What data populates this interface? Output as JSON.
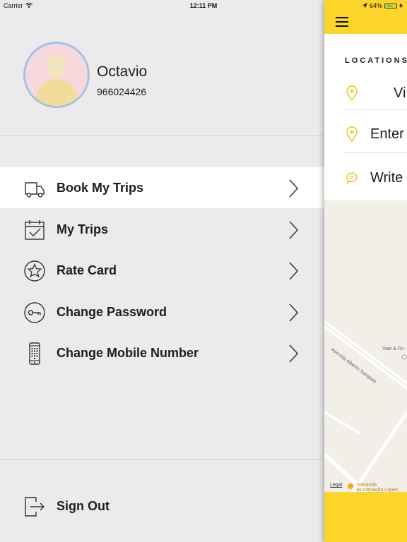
{
  "status_bar": {
    "carrier": "Carrier",
    "time": "12:11 PM",
    "battery": "64%"
  },
  "profile": {
    "name": "Octavio",
    "phone": "966024426"
  },
  "menu": {
    "items": [
      {
        "label": "Book My Trips",
        "icon": "truck-icon",
        "active": true
      },
      {
        "label": "My Trips",
        "icon": "calendar-check-icon",
        "active": false
      },
      {
        "label": "Rate Card",
        "icon": "star-icon",
        "active": false
      },
      {
        "label": "Change Password",
        "icon": "key-icon",
        "active": false
      },
      {
        "label": "Change Mobile Number",
        "icon": "mobile-phone-icon",
        "active": false
      }
    ],
    "sign_out_label": "Sign Out",
    "sign_out_icon": "sign-out-icon"
  },
  "panel": {
    "locations_title": "LOCATIONS",
    "rows": [
      {
        "text": "Vi",
        "icon": "location-pin-icon"
      },
      {
        "text": "Enter",
        "icon": "location-pin-icon"
      },
      {
        "text": "Write",
        "icon": "chat-bubble-icon"
      }
    ],
    "map": {
      "labels": [
        "Avenida Alberto Sampaio",
        "Vale & Ru",
        "Norvinda",
        "Encarnação Lopes",
        "Legal"
      ]
    }
  },
  "colors": {
    "accent": "#fbd52a",
    "drawer_bg": "#ebebec",
    "active_item_bg": "#ffffff",
    "pin": "#f4c21e"
  }
}
